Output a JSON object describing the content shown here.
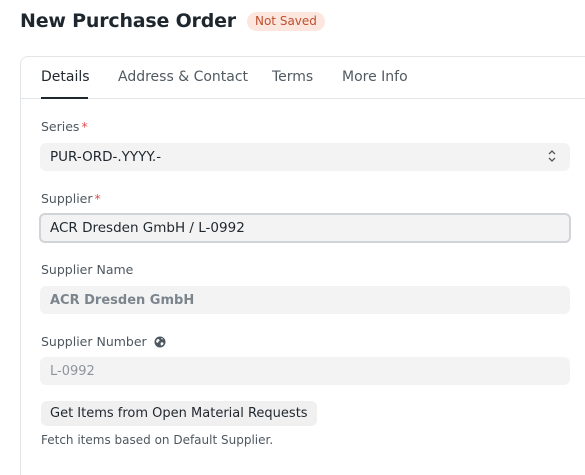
{
  "header": {
    "title": "New Purchase Order",
    "status": "Not Saved"
  },
  "tabs": [
    {
      "label": "Details",
      "active": true
    },
    {
      "label": "Address & Contact",
      "active": false
    },
    {
      "label": "Terms",
      "active": false
    },
    {
      "label": "More Info",
      "active": false
    }
  ],
  "fields": {
    "series": {
      "label": "Series",
      "required": "*",
      "value": "PUR-ORD-.YYYY.-"
    },
    "supplier": {
      "label": "Supplier",
      "required": "*",
      "value": "ACR Dresden GmbH / L-0992"
    },
    "supplier_name": {
      "label": "Supplier Name",
      "value": "ACR Dresden GmbH"
    },
    "supplier_number": {
      "label": "Supplier Number",
      "value": "L-0992"
    }
  },
  "actions": {
    "get_items_label": "Get Items from Open Material Requests",
    "get_items_help": "Fetch items based on Default Supplier."
  },
  "colors": {
    "status_bg": "#fde6de",
    "status_text": "#c0502f",
    "required": "#e24c4c"
  }
}
